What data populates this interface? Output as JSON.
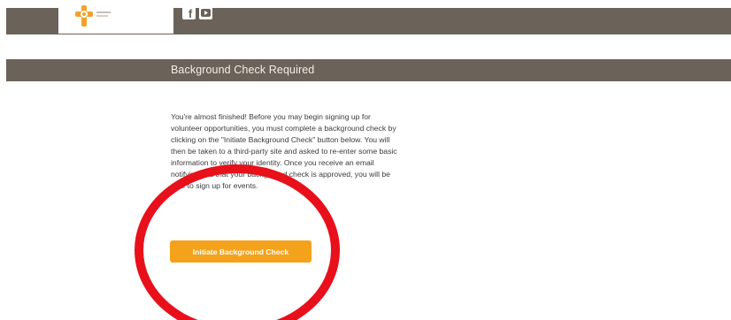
{
  "header": {
    "logo_icon": "cross-logo-icon",
    "social": [
      {
        "icon": "facebook-icon",
        "glyph": "f"
      },
      {
        "icon": "youtube-icon"
      }
    ]
  },
  "page": {
    "title": "Background Check Required",
    "message": "You're almost finished! Before you may begin signing up for volunteer opportunities, you must complete a background check by clicking on the \"Initiate Background Check\" button below. You will then be taken to a third-party site and asked to re-enter some basic information to verify your identity. Once you receive an email notifying you that your background check is approved, you will be able to sign up for events.",
    "button_label": "Initiate Background Check"
  },
  "colors": {
    "header_bar": "#6b6259",
    "button": "#f4a21b",
    "annotation": "#e8101a",
    "logo": "#f0a32a"
  }
}
